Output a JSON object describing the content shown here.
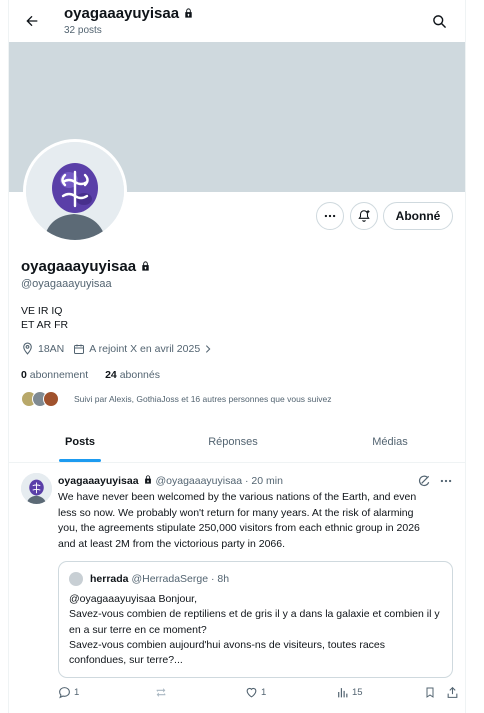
{
  "header": {
    "back_icon": "arrow-left-icon",
    "name": "oyagaaayuyisaa",
    "posts_count": "32 posts",
    "search_icon": "search-icon"
  },
  "profile": {
    "name": "oyagaaayuyisaa",
    "handle": "@oyagaaayuyisaa",
    "bio_line1": "VE IR IQ",
    "bio_line2": "ET AR FR",
    "location": "18AN",
    "joined": "A rejoint X en avril 2025",
    "following_count": "0",
    "following_label": "abonnement",
    "followers_count": "24",
    "followers_label": "abonnés",
    "followed_by": "Suivi par Alexis, GothiaJoss et 16 autres personnes que vous suivez",
    "subscribed_label": "Abonné"
  },
  "tabs": [
    {
      "label": "Posts",
      "active": true
    },
    {
      "label": "Réponses",
      "active": false
    },
    {
      "label": "Médias",
      "active": false
    }
  ],
  "tweet": {
    "name": "oyagaaayuyisaa",
    "handle": "@oyagaaayuyisaa",
    "separator": "·",
    "time": "20 min",
    "text": "We have never been welcomed by the various nations of the Earth, and even less so now. We probably won't return for many years. At the risk of alarming you, the agreements stipulate 250,000 visitors from each ethnic group in 2026 and at least 2M from the victorious party in 2066.",
    "quote": {
      "name": "herrada",
      "handle": "@HerradaSerge",
      "separator": "·",
      "time": "8h",
      "line1": "@oyagaaayuyisaa Bonjour,",
      "line2": "Savez-vous combien de reptiliens et de gris il y a dans la galaxie et combien il y en a sur terre en ce moment?",
      "line3": "Savez-vous combien aujourd'hui avons-ns de visiteurs, toutes races confondues, sur terre?..."
    },
    "replies": "1",
    "likes": "1",
    "views": "15"
  },
  "colors": {
    "accent": "#1d9bf0",
    "banner": "#cfd9de",
    "avatar_purple": "#6b4fb8"
  }
}
